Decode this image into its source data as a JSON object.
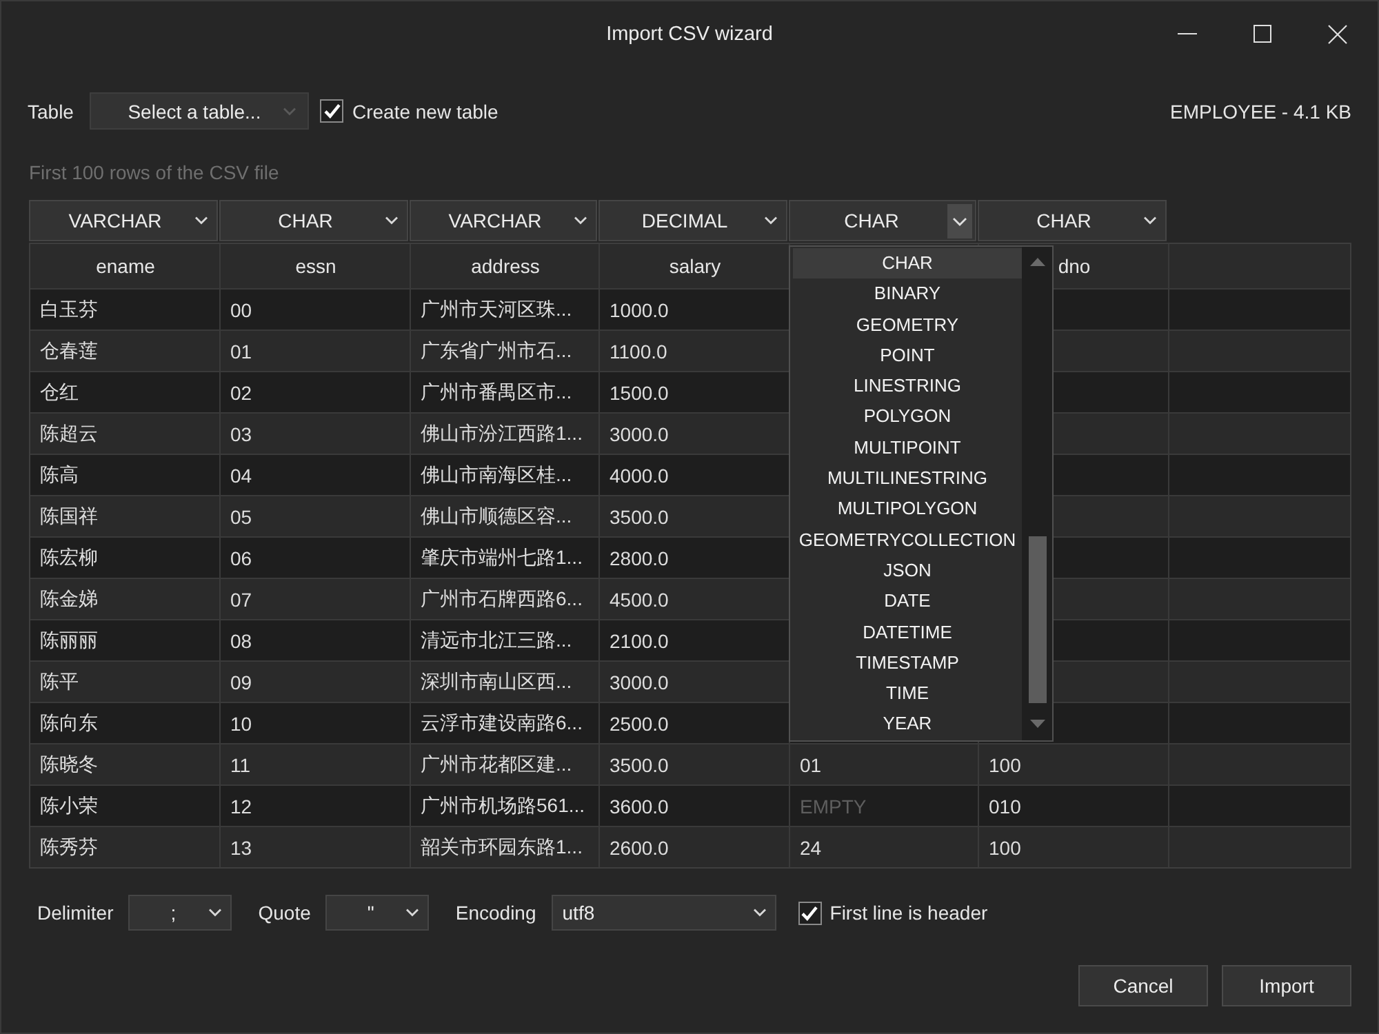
{
  "window": {
    "title": "Import CSV wizard"
  },
  "table_picker": {
    "label": "Table",
    "value": "Select a table...",
    "disabled": true
  },
  "create_new_table": {
    "label": "Create new table",
    "checked": true
  },
  "file_info": "EMPLOYEE - 4.1 KB",
  "preview_caption": "First 100 rows of the CSV file",
  "table": {
    "columns": [
      {
        "type": "VARCHAR",
        "open": false,
        "header": "ename"
      },
      {
        "type": "CHAR",
        "open": false,
        "header": "essn"
      },
      {
        "type": "VARCHAR",
        "open": false,
        "header": "address"
      },
      {
        "type": "DECIMAL",
        "open": false,
        "header": "salary"
      },
      {
        "type": "CHAR",
        "open": true,
        "options": [
          {
            "label": "CHAR",
            "selected": true
          },
          {
            "label": "BINARY",
            "selected": false
          },
          {
            "label": "GEOMETRY",
            "selected": false
          },
          {
            "label": "POINT",
            "selected": false
          },
          {
            "label": "LINESTRING",
            "selected": false
          },
          {
            "label": "POLYGON",
            "selected": false
          },
          {
            "label": "MULTIPOINT",
            "selected": false
          },
          {
            "label": "MULTILINESTRING",
            "selected": false
          },
          {
            "label": "MULTIPOLYGON",
            "selected": false
          },
          {
            "label": "GEOMETRYCOLLECTION",
            "selected": false
          },
          {
            "label": "JSON",
            "selected": false
          },
          {
            "label": "DATE",
            "selected": false
          },
          {
            "label": "DATETIME",
            "selected": false
          },
          {
            "label": "TIMESTAMP",
            "selected": false
          },
          {
            "label": "TIME",
            "selected": false
          },
          {
            "label": "YEAR",
            "selected": false
          }
        ]
      },
      {
        "type": "CHAR",
        "open": false,
        "header": "dno"
      }
    ],
    "rows": [
      {
        "cells": [
          {
            "text": "白玉芬",
            "null": false
          },
          {
            "text": "00",
            "null": false
          },
          {
            "text": "广州市天河区珠...",
            "null": false
          },
          {
            "text": "1000.0",
            "null": false
          }
        ]
      },
      {
        "cells": [
          {
            "text": "仓春莲",
            "null": false
          },
          {
            "text": "01",
            "null": false
          },
          {
            "text": "广东省广州市石...",
            "null": false
          },
          {
            "text": "1100.0",
            "null": false
          }
        ]
      },
      {
        "cells": [
          {
            "text": "仓红",
            "null": false
          },
          {
            "text": "02",
            "null": false
          },
          {
            "text": "广州市番禺区市...",
            "null": false
          },
          {
            "text": "1500.0",
            "null": false
          }
        ]
      },
      {
        "cells": [
          {
            "text": "陈超云",
            "null": false
          },
          {
            "text": "03",
            "null": false
          },
          {
            "text": "佛山市汾江西路1...",
            "null": false
          },
          {
            "text": "3000.0",
            "null": false
          }
        ]
      },
      {
        "cells": [
          {
            "text": "陈高",
            "null": false
          },
          {
            "text": "04",
            "null": false
          },
          {
            "text": "佛山市南海区桂...",
            "null": false
          },
          {
            "text": "4000.0",
            "null": false
          }
        ]
      },
      {
        "cells": [
          {
            "text": "陈国祥",
            "null": false
          },
          {
            "text": "05",
            "null": false
          },
          {
            "text": "佛山市顺德区容...",
            "null": false
          },
          {
            "text": "3500.0",
            "null": false
          }
        ]
      },
      {
        "cells": [
          {
            "text": "陈宏柳",
            "null": false
          },
          {
            "text": "06",
            "null": false
          },
          {
            "text": "肇庆市端州七路1...",
            "null": false
          },
          {
            "text": "2800.0",
            "null": false
          }
        ]
      },
      {
        "cells": [
          {
            "text": "陈金娣",
            "null": false
          },
          {
            "text": "07",
            "null": false
          },
          {
            "text": "广州市石牌西路6...",
            "null": false
          },
          {
            "text": "4500.0",
            "null": false
          }
        ]
      },
      {
        "cells": [
          {
            "text": "陈丽丽",
            "null": false
          },
          {
            "text": "08",
            "null": false
          },
          {
            "text": "清远市北江三路...",
            "null": false
          },
          {
            "text": "2100.0",
            "null": false
          }
        ]
      },
      {
        "cells": [
          {
            "text": "陈平",
            "null": false
          },
          {
            "text": "09",
            "null": false
          },
          {
            "text": "深圳市南山区西...",
            "null": false
          },
          {
            "text": "3000.0",
            "null": false
          }
        ]
      },
      {
        "cells": [
          {
            "text": "陈向东",
            "null": false
          },
          {
            "text": "10",
            "null": false
          },
          {
            "text": "云浮市建设南路6...",
            "null": false
          },
          {
            "text": "2500.0",
            "null": false
          }
        ]
      },
      {
        "cells": [
          {
            "text": "陈晓冬",
            "null": false
          },
          {
            "text": "11",
            "null": false
          },
          {
            "text": "广州市花都区建...",
            "null": false
          },
          {
            "text": "3500.0",
            "null": false
          },
          {
            "text": "01",
            "null": false
          },
          {
            "text": "100",
            "null": false
          }
        ]
      },
      {
        "cells": [
          {
            "text": "陈小荣",
            "null": false
          },
          {
            "text": "12",
            "null": false
          },
          {
            "text": "广州市机场路561...",
            "null": false
          },
          {
            "text": "3600.0",
            "null": false
          },
          {
            "text": "EMPTY",
            "null": true
          },
          {
            "text": "010",
            "null": false
          }
        ]
      },
      {
        "cells": [
          {
            "text": "陈秀芬",
            "null": false
          },
          {
            "text": "13",
            "null": false
          },
          {
            "text": "韶关市环园东路1...",
            "null": false
          },
          {
            "text": "2600.0",
            "null": false
          },
          {
            "text": "24",
            "null": false
          },
          {
            "text": "100",
            "null": false
          }
        ]
      }
    ]
  },
  "import_options": {
    "delimiter": {
      "label": "Delimiter",
      "value": ";"
    },
    "quote": {
      "label": "Quote",
      "value": "\""
    },
    "encoding": {
      "label": "Encoding",
      "value": "utf8"
    },
    "first_line_is_header": {
      "label": "First line is header",
      "checked": true
    }
  },
  "buttons": [
    "Cancel",
    "Import"
  ]
}
